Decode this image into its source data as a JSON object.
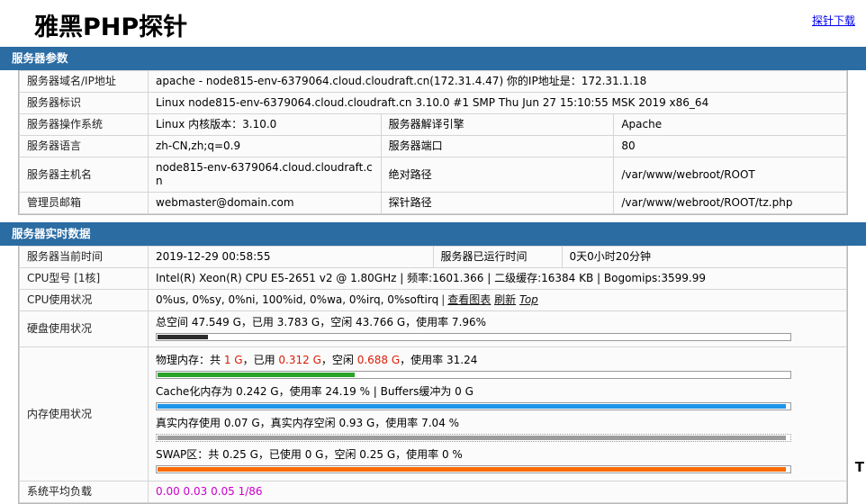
{
  "header": {
    "title": "雅黑PHP探针",
    "download_label": "探针下载"
  },
  "server_params": {
    "section_title": "服务器参数",
    "rows": [
      {
        "label": "服务器域名/IP地址",
        "value": "apache - node815-env-6379064.cloud.cloudraft.cn(172.31.4.47)  你的IP地址是：172.31.1.18"
      },
      {
        "label": "服务器标识",
        "value": "Linux node815-env-6379064.cloud.cloudraft.cn 3.10.0 #1 SMP Thu Jun 27 15:10:55 MSK 2019 x86_64"
      },
      {
        "label": "服务器操作系统",
        "value": "Linux  内核版本：3.10.0",
        "label2": "服务器解译引擎",
        "value2": "Apache"
      },
      {
        "label": "服务器语言",
        "value": "zh-CN,zh;q=0.9",
        "label2": "服务器端口",
        "value2": "80"
      },
      {
        "label": "服务器主机名",
        "value": "node815-env-6379064.cloud.cloudraft.cn",
        "label2": "绝对路径",
        "value2": "/var/www/webroot/ROOT"
      },
      {
        "label": "管理员邮箱",
        "value": "webmaster@domain.com",
        "label2": "探针路径",
        "value2": "/var/www/webroot/ROOT/tz.php"
      }
    ]
  },
  "realtime": {
    "section_title": "服务器实时数据",
    "time_label": "服务器当前时间",
    "time_value": "2019-12-29 00:58:55",
    "uptime_label": "服务器已运行时间",
    "uptime_value": "0天0小时20分钟",
    "cpu_model_label": "CPU型号 [1核]",
    "cpu_model_value": "Intel(R) Xeon(R) CPU E5-2651 v2 @ 1.80GHz | 频率:1601.366 | 二级缓存:16384 KB | Bogomips:3599.99",
    "cpu_usage_label": "CPU使用状况",
    "cpu_usage_value": "0%us, 0%sy, 0%ni, 100%id, 0%wa, 0%irq, 0%softirq",
    "cpu_chart_link": "查看图表",
    "cpu_refresh_link": "刷新",
    "cpu_top_link": "Top",
    "disk_label": "硬盘使用状况",
    "disk_text": "总空间 47.549 G，已用 3.783 G，空闲 43.766 G，使用率 7.96%",
    "disk_percent": 7.96,
    "memory_label": "内存使用状况",
    "memory": [
      {
        "name": "physical-memory",
        "prefix": "物理内存：共 ",
        "total": "1 G",
        "mid1": "，已用 ",
        "used": "0.312 G",
        "mid2": "，空闲 ",
        "free": "0.688 G",
        "suffix": "，使用率 31.24",
        "percent": 31.24,
        "color": "green"
      },
      {
        "name": "cache-memory",
        "text": "Cache化内存为 0.242 G，使用率 24.19 % | Buffers缓冲为 0 G",
        "percent": 99.5,
        "color": "blue"
      },
      {
        "name": "real-memory",
        "text": "真实内存使用 0.07 G，真实内存空闲 0.93 G，使用率 7.04 %",
        "percent": 99.5,
        "color": "gray"
      },
      {
        "name": "swap-memory",
        "text": "SWAP区：共 0.25 G，已使用 0 G，空闲 0.25 G，使用率 0 %",
        "percent": 99.5,
        "color": "orange"
      }
    ],
    "load_label": "系统平均负载",
    "load_value": "0.00 0.03 0.05 1/86"
  },
  "footer": {
    "corner_text": "T"
  },
  "colors": {
    "section_header": "#2b6ca3",
    "link": "#0000EE",
    "highlight_red": "#d81e06",
    "load_magenta": "#cc00cc",
    "bar_green": "#2aa329",
    "bar_blue": "#1e95e8",
    "bar_gray": "#9c9c9c",
    "bar_orange": "#f96a06",
    "bar_dark": "#2d2d2d"
  }
}
